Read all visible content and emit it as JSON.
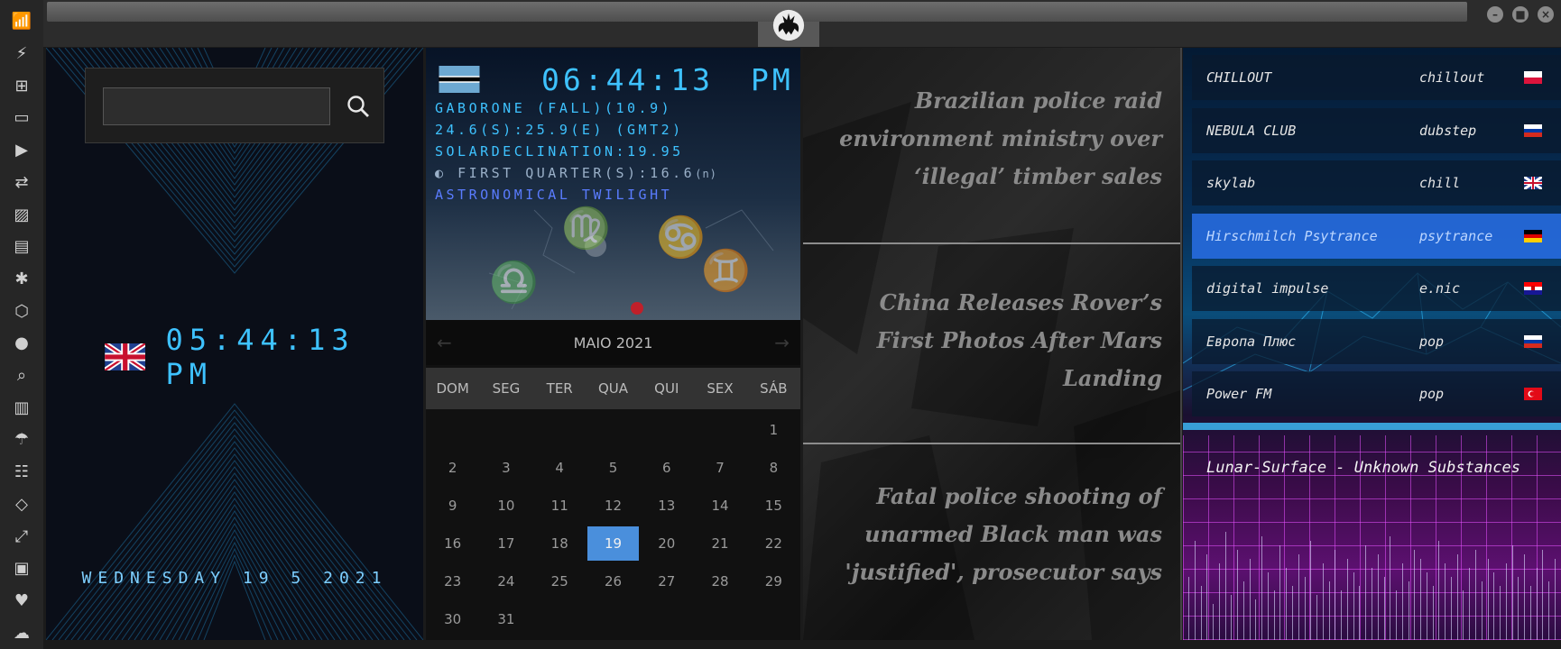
{
  "window": {
    "minimize_icon": "minimize-icon",
    "maximize_icon": "maximize-icon",
    "close_icon": "close-icon",
    "logo": "rebel-alliance-logo"
  },
  "sidebar": {
    "items": [
      {
        "icon": "wifi-icon"
      },
      {
        "icon": "lightning-icon"
      },
      {
        "icon": "windows-icon"
      },
      {
        "icon": "archive-icon"
      },
      {
        "icon": "play-icon"
      },
      {
        "icon": "translate-icon"
      },
      {
        "icon": "image-icon"
      },
      {
        "icon": "news-icon"
      },
      {
        "icon": "atom-icon"
      },
      {
        "icon": "hexagon-icon"
      },
      {
        "icon": "globe-icon"
      },
      {
        "icon": "search-icon"
      },
      {
        "icon": "map-icon"
      },
      {
        "icon": "umbrella-icon"
      },
      {
        "icon": "contacts-icon"
      },
      {
        "icon": "code-icon"
      },
      {
        "icon": "fullscreen-icon"
      },
      {
        "icon": "youtube-icon"
      },
      {
        "icon": "heart-icon"
      },
      {
        "icon": "cloud-icon"
      }
    ]
  },
  "search": {
    "placeholder": "",
    "value": ""
  },
  "uk_clock": {
    "time": "05:44:13 PM",
    "flag": "united-kingdom-flag"
  },
  "date_line": "WEDNESDAY 19 5 2021",
  "astro": {
    "flag": "botswana-flag",
    "time": "06:44:13",
    "ampm": "PM",
    "line1": "GABORONE (FALL)(10.9)",
    "line2": "24.6(S):25.9(E) (GMT2)",
    "line3": "SOLARDECLINATION:19.95",
    "line4": "FIRST QUARTER(S):16.6",
    "line4_suffix": "(n)",
    "line5": "ASTRONOMICAL TWILIGHT"
  },
  "calendar": {
    "month": "MAIO 2021",
    "weekdays": [
      "DOM",
      "SEG",
      "TER",
      "QUA",
      "QUI",
      "SEX",
      "SÁB"
    ],
    "today": 19,
    "lead_blanks": 6,
    "days": [
      "1",
      "2",
      "3",
      "4",
      "5",
      "6",
      "7",
      "8",
      "9",
      "10",
      "11",
      "12",
      "13",
      "14",
      "15",
      "16",
      "17",
      "18",
      "19",
      "20",
      "21",
      "22",
      "23",
      "24",
      "25",
      "26",
      "27",
      "28",
      "29",
      "30",
      "31"
    ]
  },
  "news": [
    {
      "title": "Brazilian police raid environment ministry over ‘illegal’ timber sales"
    },
    {
      "title": "China Releases Rover’s First Photos After Mars Landing"
    },
    {
      "title": "Fatal police shooting of unarmed Black man was 'justified', prosecutor says"
    }
  ],
  "radio": {
    "stations": [
      {
        "name": "CHILLOUT",
        "genre": "chillout",
        "flag": "poland-flag"
      },
      {
        "name": "NEBULA CLUB",
        "genre": "dubstep",
        "flag": "russia-flag"
      },
      {
        "name": "skylab",
        "genre": "chill",
        "flag": "united-kingdom-flag"
      },
      {
        "name": "Hirschmilch Psytrance",
        "genre": "psytrance",
        "flag": "germany-flag",
        "active": true
      },
      {
        "name": "digital impulse",
        "genre": "e.nic",
        "flag": "croatia-flag"
      },
      {
        "name": "Европа Плюс",
        "genre": "pop",
        "flag": "russia-flag"
      },
      {
        "name": "Power FM",
        "genre": "pop",
        "flag": "turkey-flag"
      }
    ],
    "now_playing": "Lunar-Surface - Unknown Substances"
  }
}
